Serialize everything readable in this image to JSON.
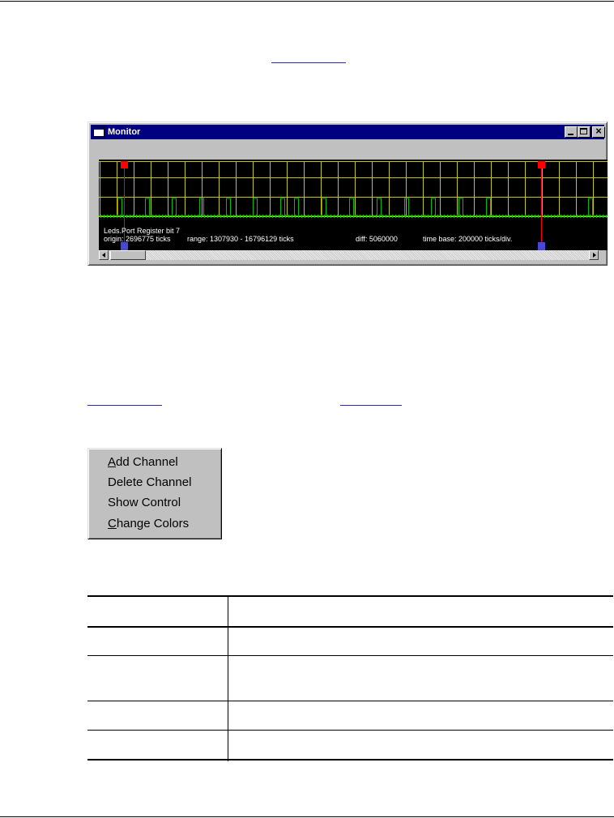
{
  "window": {
    "title": "Monitor",
    "title_bar_color": "#000080"
  },
  "scope": {
    "channel_label": "Leds.Port  Register bit 7",
    "origin_text": "origin: 2696775 ticks",
    "range_text": "range: 1307930 - 16796129 ticks",
    "diff_text": "diff: 5060000",
    "time_base_text": "time base: 200000 ticks/div.",
    "colors": {
      "background": "#000000",
      "grid": "#c8c800",
      "signal": "#00c000",
      "cursor": "#ff0000",
      "cursor_handle_bottom": "#4848d8"
    }
  },
  "context_menu": {
    "items": [
      {
        "label": "Add Channel",
        "accel": "A",
        "rest": "dd Channel"
      },
      {
        "label": "Delete Channel",
        "accel": "",
        "rest": "Delete Channel"
      },
      {
        "label": "Show Control",
        "accel": "",
        "rest": "Show Control"
      },
      {
        "label": "Change Colors",
        "accel": "C",
        "rest": "hange Colors"
      }
    ]
  },
  "icons": {
    "app": "window-icon",
    "minimize": "minimize-icon",
    "maximize": "maximize-icon",
    "close": "close-icon",
    "scroll_left": "arrow-left-icon",
    "scroll_right": "arrow-right-icon"
  },
  "link_color": "#2a2ab8"
}
